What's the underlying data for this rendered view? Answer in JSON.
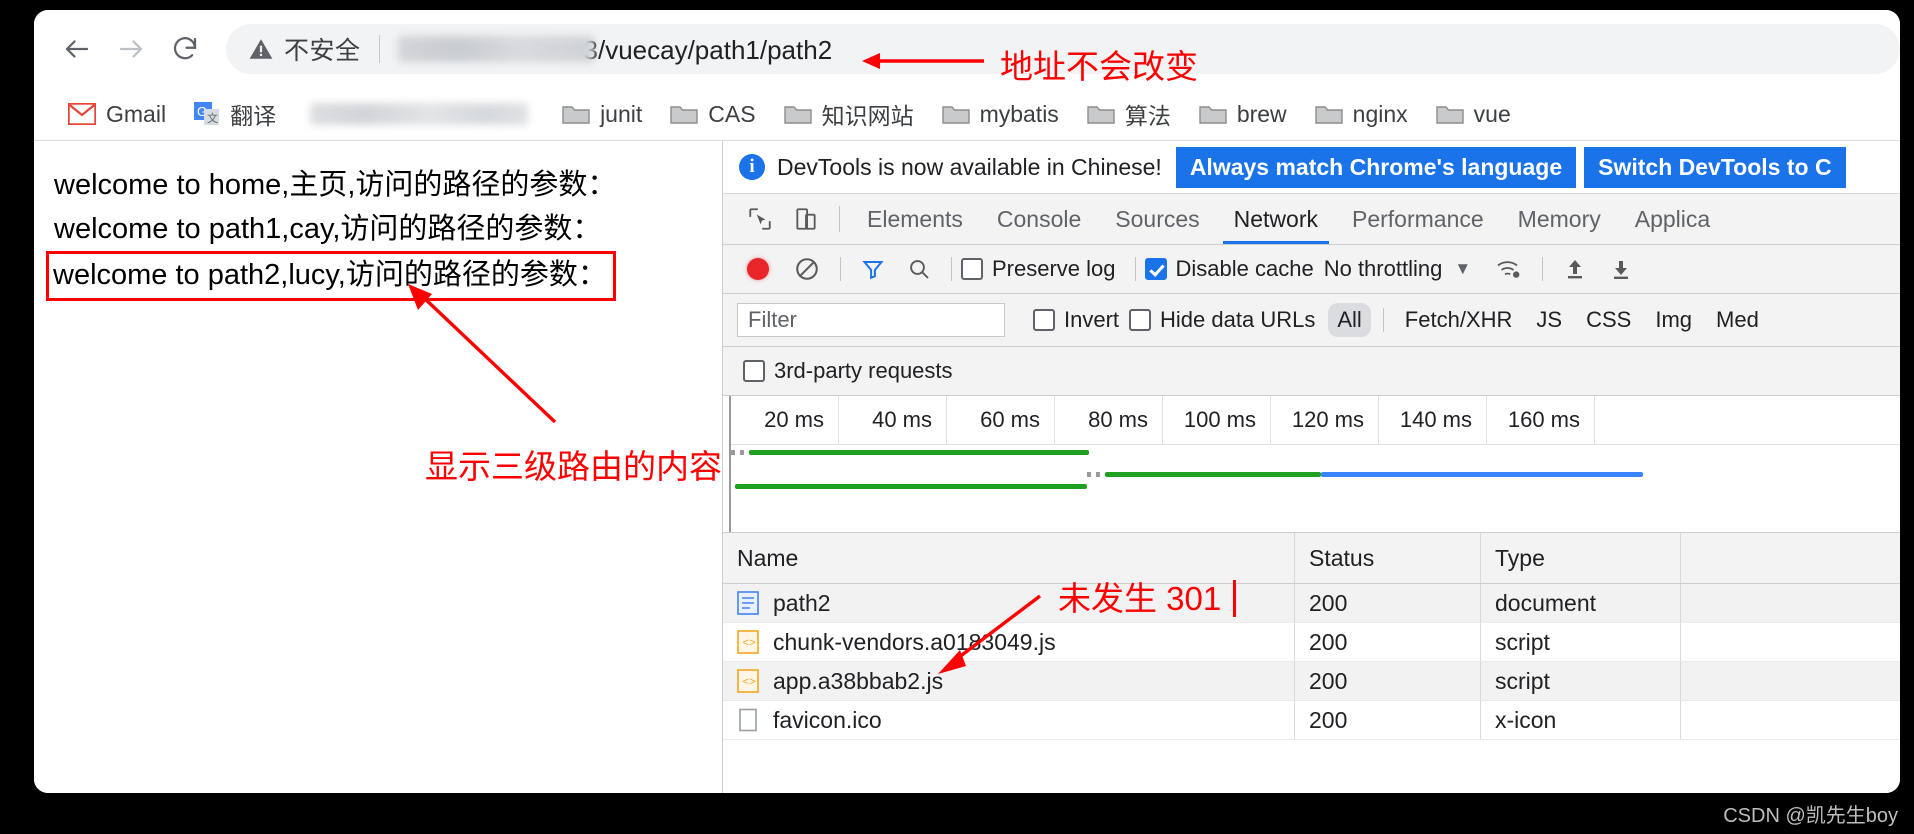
{
  "browser": {
    "nav": {
      "back": "back-arrow",
      "forward": "forward-arrow",
      "reload": "reload"
    },
    "omnibox": {
      "security_icon": "warning-triangle-icon",
      "security_label": "不安全",
      "url_visible": "3/vuecay/path1/path2",
      "url_redacted": true
    },
    "bookmarks": [
      {
        "label": "Gmail",
        "icon": "gmail-icon"
      },
      {
        "label": "翻译",
        "icon": "google-translate-icon"
      },
      {
        "label": "",
        "icon": "blurred-bookmark",
        "blurred": true
      },
      {
        "label": "junit",
        "icon": "folder-icon"
      },
      {
        "label": "CAS",
        "icon": "folder-icon"
      },
      {
        "label": "知识网站",
        "icon": "folder-icon"
      },
      {
        "label": "mybatis",
        "icon": "folder-icon"
      },
      {
        "label": "算法",
        "icon": "folder-icon"
      },
      {
        "label": "brew",
        "icon": "folder-icon"
      },
      {
        "label": "nginx",
        "icon": "folder-icon"
      },
      {
        "label": "vue",
        "icon": "folder-icon"
      }
    ]
  },
  "page": {
    "lines": [
      "welcome to home,主页,访问的路径的参数：",
      "welcome to path1,cay,访问的路径的参数：",
      "welcome to path2,lucy,访问的路径的参数："
    ]
  },
  "devtools": {
    "banner": {
      "icon": "info-icon",
      "message": "DevTools is now available in Chinese!",
      "primary_button": "Always match Chrome's language",
      "secondary_button": "Switch DevTools to C"
    },
    "tabs": [
      {
        "label": "Elements",
        "active": false
      },
      {
        "label": "Console",
        "active": false
      },
      {
        "label": "Sources",
        "active": false
      },
      {
        "label": "Network",
        "active": true
      },
      {
        "label": "Performance",
        "active": false
      },
      {
        "label": "Memory",
        "active": false
      },
      {
        "label": "Applica",
        "active": false
      }
    ],
    "toolbar": {
      "record_label": "record-button",
      "clear_label": "clear-button",
      "filter_label": "filter-toggle",
      "search_label": "search-button",
      "preserve_log": {
        "label": "Preserve log",
        "checked": false
      },
      "disable_cache": {
        "label": "Disable cache",
        "checked": true
      },
      "throttling": "No throttling",
      "import_label": "import-har",
      "export_label": "export-har"
    },
    "filterbar": {
      "input_value": "",
      "input_placeholder": "Filter",
      "invert": {
        "label": "Invert",
        "checked": false
      },
      "hide_data_urls": {
        "label": "Hide data URLs",
        "checked": false
      },
      "types": [
        "All",
        "Fetch/XHR",
        "JS",
        "CSS",
        "Img",
        "Med"
      ],
      "selected_type": "All",
      "third_party": {
        "label": "3rd-party requests",
        "checked": false
      }
    },
    "timeline": {
      "ticks": [
        "20 ms",
        "40 ms",
        "60 ms",
        "80 ms",
        "100 ms",
        "120 ms",
        "140 ms",
        "160 ms"
      ]
    },
    "table": {
      "columns": [
        "Name",
        "Status",
        "Type"
      ],
      "rows": [
        {
          "name": "path2",
          "status": "200",
          "type": "document",
          "icon": "document-icon"
        },
        {
          "name": "chunk-vendors.a0183049.js",
          "status": "200",
          "type": "script",
          "icon": "script-icon"
        },
        {
          "name": "app.a38bbab2.js",
          "status": "200",
          "type": "script",
          "icon": "script-icon"
        },
        {
          "name": "favicon.ico",
          "status": "200",
          "type": "x-icon",
          "icon": "generic-file-icon"
        }
      ]
    }
  },
  "annotations": {
    "url_note": "地址不会改变",
    "route_note": "显示三级路由的内容",
    "no_301_note": "未发生 301",
    "color": "#ff0000"
  },
  "watermark": "CSDN @凯先生boy"
}
